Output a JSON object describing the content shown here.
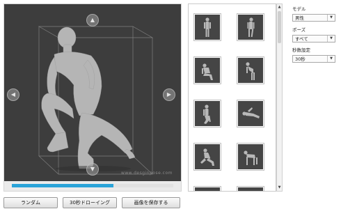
{
  "viewport": {
    "watermark": "www.desginpose.com",
    "nav": {
      "up": "up-arrow-icon",
      "down": "down-arrow-icon",
      "left": "left-arrow-icon",
      "right": "right-arrow-icon"
    },
    "progress_fraction": 0.63
  },
  "buttons": {
    "random": "ランダム",
    "thirty_sec": "30秒ドローイング",
    "save_image": "画像を保存する"
  },
  "gallery": {
    "thumbnails": [
      "standing-pose-icon",
      "standing-pose-icon",
      "crouching-pose-icon",
      "bending-pose-icon",
      "kneeling-pose-icon",
      "lying-pose-icon",
      "lunging-pose-icon",
      "crawling-pose-icon",
      "pose-icon",
      "pose-icon"
    ]
  },
  "panel": {
    "model_label": "モデル",
    "model_value": "男性",
    "pose_label": "ポーズ",
    "pose_value": "すべて",
    "seconds_label": "秒数設定",
    "seconds_value": "30秒"
  },
  "colors": {
    "stage_bg": "#3d3d3d",
    "progress": "#2aa4d9",
    "figure": "#b4b4b4"
  }
}
